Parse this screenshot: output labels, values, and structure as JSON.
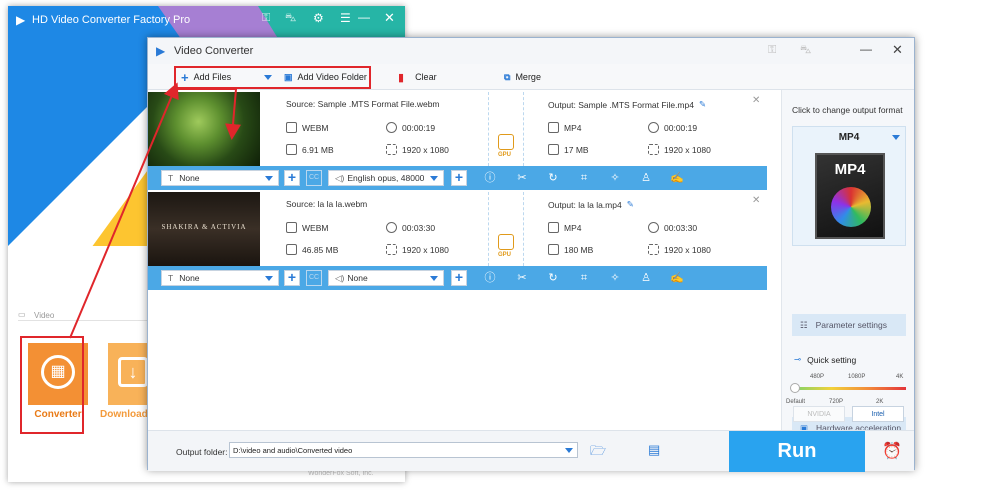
{
  "main_app": {
    "title": "HD Video Converter Factory Pro",
    "section_label": "Video",
    "converter_label": "Converter",
    "downloader_label": "Download",
    "footer": "WonderFox Soft, Inc."
  },
  "dialog": {
    "title": "Video Converter",
    "toolbar": {
      "add_files": "Add Files",
      "add_folder": "Add Video Folder",
      "clear": "Clear",
      "merge": "Merge"
    },
    "files": [
      {
        "source": "Source: Sample .MTS Format File.webm",
        "src_format": "WEBM",
        "src_duration": "00:00:19",
        "src_size": "6.91 MB",
        "src_res": "1920 x 1080",
        "output": "Output: Sample .MTS Format File.mp4",
        "out_format": "MP4",
        "out_duration": "00:00:19",
        "out_size": "17 MB",
        "out_res": "1920 x 1080",
        "subtitle": "None",
        "audio": "English opus, 48000"
      },
      {
        "source": "Source: la la la.webm",
        "src_format": "WEBM",
        "src_duration": "00:03:30",
        "src_size": "46.85 MB",
        "src_res": "1920 x 1080",
        "output": "Output: la la la.mp4",
        "out_format": "MP4",
        "out_duration": "00:03:30",
        "out_size": "180 MB",
        "out_res": "1920 x 1080",
        "subtitle": "None",
        "audio": "None",
        "thumb_text": "SHAKIRA & ACTIVIA"
      }
    ],
    "gpu_badge": "GPU",
    "cc_label": "CC",
    "right_panel": {
      "hint": "Click to change output format",
      "format": "MP4",
      "param_settings": "Parameter settings",
      "quick_setting": "Quick setting",
      "quality_top": [
        "480P",
        "1080P",
        "4K"
      ],
      "quality_bottom": [
        "Default",
        "720P",
        "2K"
      ],
      "hw_accel": "Hardware acceleration",
      "nvidia": "NVIDIA",
      "intel": "Intel"
    },
    "output_folder_label": "Output folder:",
    "output_folder_path": "D:\\video and audio\\Converted video",
    "run": "Run"
  },
  "colors": {
    "accent": "#29a3ef",
    "strip": "#4ba8e6",
    "highlight": "#e0262b",
    "converter_orange": "#f39034"
  }
}
